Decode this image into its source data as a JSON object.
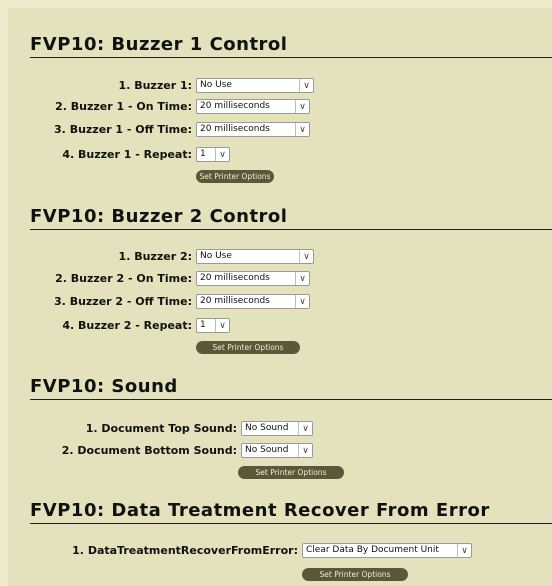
{
  "sections": [
    {
      "title": "FVP10: Buzzer 1 Control",
      "rows": [
        {
          "label": "1. Buzzer 1:",
          "value": "No Use"
        },
        {
          "label": "2. Buzzer 1 - On Time:",
          "value": "20 milliseconds"
        },
        {
          "label": "3. Buzzer 1 - Off Time:",
          "value": "20 milliseconds"
        },
        {
          "label": "4. Buzzer 1 - Repeat:",
          "value": "1"
        }
      ],
      "button": "Set Printer Options"
    },
    {
      "title": "FVP10: Buzzer 2 Control",
      "rows": [
        {
          "label": "1. Buzzer 2:",
          "value": "No Use"
        },
        {
          "label": "2. Buzzer 2 - On Time:",
          "value": "20 milliseconds"
        },
        {
          "label": "3. Buzzer 2 - Off Time:",
          "value": "20 milliseconds"
        },
        {
          "label": "4. Buzzer 2 - Repeat:",
          "value": "1"
        }
      ],
      "button": "Set Printer Options"
    },
    {
      "title": "FVP10: Sound",
      "rows": [
        {
          "label": "1. Document Top Sound:",
          "value": "No Sound"
        },
        {
          "label": "2. Document Bottom Sound:",
          "value": "No Sound"
        }
      ],
      "button": "Set Printer Options"
    },
    {
      "title": "FVP10: Data Treatment Recover From Error",
      "rows": [
        {
          "label": "1. DataTreatmentRecoverFromError:",
          "value": "Clear Data By Document Unit"
        }
      ],
      "button": "Set Printer Options"
    }
  ]
}
